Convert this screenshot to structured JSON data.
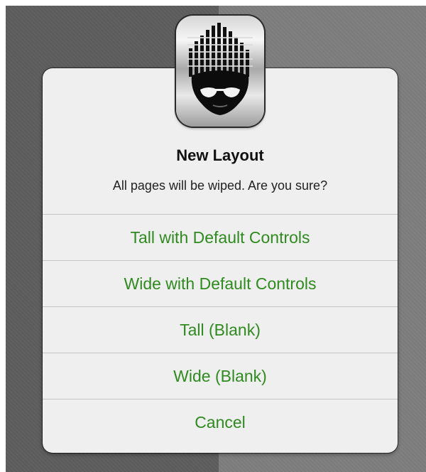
{
  "dialog": {
    "title": "New Layout",
    "message": "All pages will be wiped. Are you sure?",
    "app_icon": "equalizer-face-icon",
    "actions": [
      {
        "label": "Tall with Default Controls"
      },
      {
        "label": "Wide with Default Controls"
      },
      {
        "label": "Tall (Blank)"
      },
      {
        "label": "Wide (Blank)"
      },
      {
        "label": "Cancel"
      }
    ]
  },
  "colors": {
    "action_text": "#2f8a1f",
    "dialog_bg": "#efefef",
    "separator": "#c4c4c4",
    "backdrop_left": "#5d5d5d",
    "backdrop_right": "#7e7e7e"
  }
}
